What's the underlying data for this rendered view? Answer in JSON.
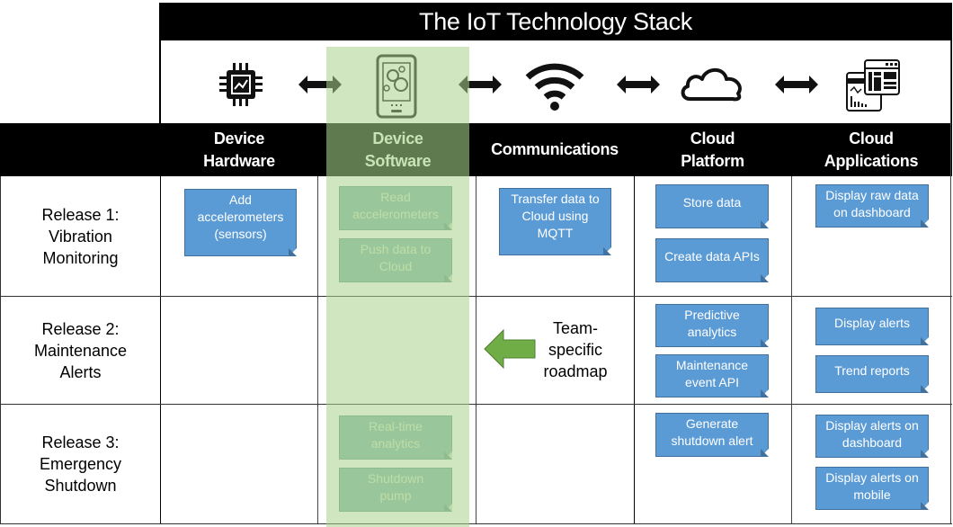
{
  "title": "The IoT Technology Stack",
  "stack_icons": [
    {
      "name": "chip-icon",
      "label": "Device Hardware"
    },
    {
      "name": "mobile-gears-icon",
      "label": "Device Software"
    },
    {
      "name": "wifi-icon",
      "label": "Communications"
    },
    {
      "name": "cloud-icon",
      "label": "Cloud Platform"
    },
    {
      "name": "dashboard-icon",
      "label": "Cloud Applications"
    }
  ],
  "columns": [
    {
      "line1": "Device",
      "line2": "Hardware"
    },
    {
      "line1": "Device",
      "line2": "Software"
    },
    {
      "line1": "Communications",
      "line2": ""
    },
    {
      "line1": "Cloud",
      "line2": "Platform"
    },
    {
      "line1": "Cloud",
      "line2": "Applications"
    }
  ],
  "highlighted_column": "Device Software",
  "rows": [
    {
      "label": [
        "Release 1:",
        "Vibration",
        "Monitoring"
      ],
      "hardware": [
        [
          "Add",
          "accelerometers",
          "(sensors)"
        ]
      ],
      "software": [
        [
          "Read",
          "accelerometers"
        ],
        [
          "Push data to",
          "Cloud"
        ]
      ],
      "communications": [
        [
          "Transfer data to",
          "Cloud using",
          "MQTT"
        ]
      ],
      "platform": [
        [
          "Store data"
        ],
        [
          "Create data APIs"
        ]
      ],
      "applications": [
        [
          "Display raw data",
          "on dashboard"
        ]
      ]
    },
    {
      "label": [
        "Release 2:",
        "Maintenance",
        "Alerts"
      ],
      "hardware": [],
      "software": [],
      "communications": [],
      "platform": [
        [
          "Predictive",
          "analytics"
        ],
        [
          "Maintenance",
          "event API"
        ]
      ],
      "applications": [
        [
          "Display alerts"
        ],
        [
          "Trend reports"
        ]
      ]
    },
    {
      "label": [
        "Release 3:",
        "Emergency",
        "Shutdown"
      ],
      "hardware": [],
      "software": [
        [
          "Real-time",
          "analytics"
        ],
        [
          "Shutdown",
          "pump"
        ]
      ],
      "communications": [],
      "platform": [
        [
          "Generate",
          "shutdown alert"
        ]
      ],
      "applications": [
        [
          "Display alerts on",
          "dashboard"
        ],
        [
          "Display alerts on",
          "mobile"
        ]
      ]
    }
  ],
  "annotation": {
    "lines": [
      "Team-",
      "specific",
      "roadmap"
    ],
    "arrow_color": "#70ad47"
  },
  "colors": {
    "note_fill": "#5b9bd5",
    "note_border": "#41719c",
    "highlight": "#c5e0b4",
    "header_bg": "#000000"
  }
}
